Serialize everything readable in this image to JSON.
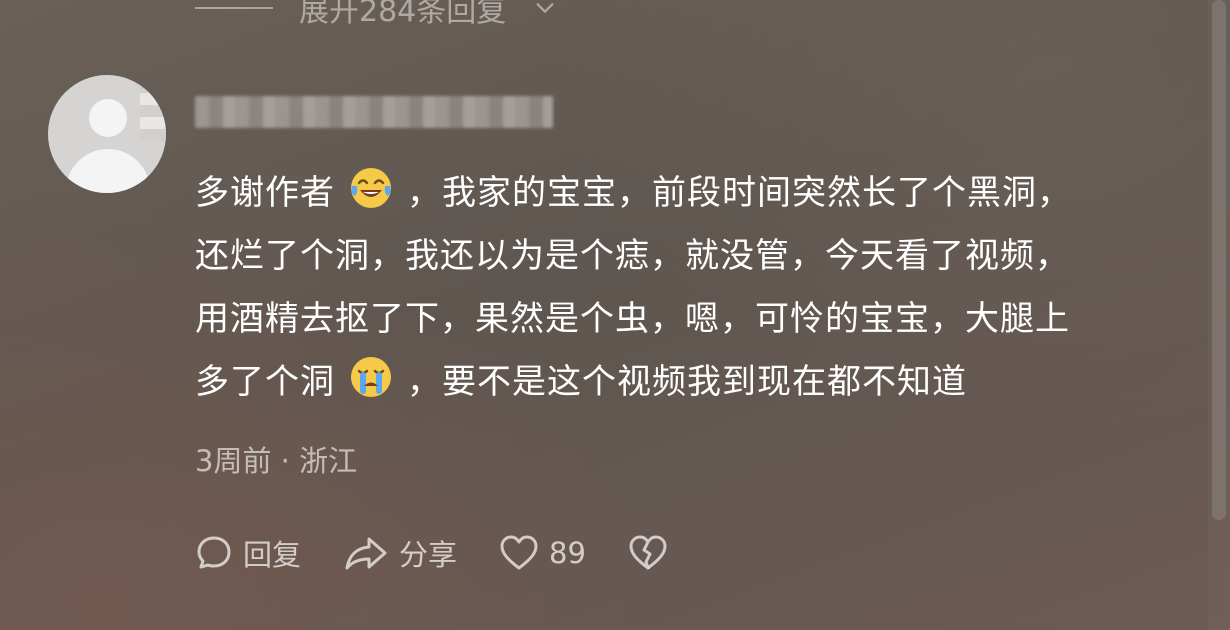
{
  "collapsed_replies": {
    "label": "展开284条回复"
  },
  "comment": {
    "user": {
      "avatar_icon": "default-avatar-icon"
    },
    "lines": [
      {
        "before": "多谢作者",
        "emoji": "tears-of-joy-emoji",
        "after": "，我家的宝宝，前段时间突然长了个黑洞，"
      },
      {
        "text": "还烂了个洞，我还以为是个痣，就没管，今天看了视频，"
      },
      {
        "text": "用酒精去抠了下，果然是个虫，嗯，可怜的宝宝，大腿上"
      },
      {
        "before": "多了个洞",
        "emoji": "crying-emoji",
        "after": "，要不是这个视频我到现在都不知道"
      }
    ],
    "meta": "3周前 · 浙江",
    "actions": {
      "reply_label": "回复",
      "share_label": "分享",
      "like_count": "89"
    }
  },
  "colors": {
    "text": "#ffffff",
    "meta": "#dcd6d2",
    "emoji_yellow": "#f7c948",
    "emoji_tear": "#5aa9f0"
  }
}
